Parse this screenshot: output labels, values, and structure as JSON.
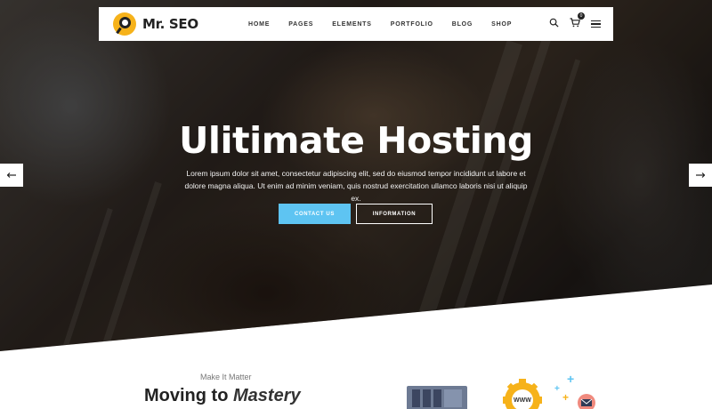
{
  "brand": {
    "name": "Mr. SEO"
  },
  "nav": {
    "items": [
      "HOME",
      "PAGES",
      "ELEMENTS",
      "PORTFOLIO",
      "BLOG",
      "SHOP"
    ],
    "cart_count": "0"
  },
  "icons": {
    "search": "search-icon",
    "cart": "cart-icon",
    "menu": "hamburger-menu-icon",
    "prev": "arrow-left-icon",
    "next": "arrow-right-icon"
  },
  "hero": {
    "title": "Ulitimate Hosting",
    "description": "Lorem ipsum dolor sit amet, consectetur adipiscing elit, sed do eiusmod tempor incididunt ut labore et dolore magna aliqua. Ut enim ad minim veniam, quis nostrud exercitation ullamco laboris nisi ut aliquip ex.",
    "primary_button": "CONTACT US",
    "secondary_button": "INFORMATION"
  },
  "section": {
    "kicker": "Make It Matter",
    "title_bold": "Moving to",
    "title_italic": "Mastery",
    "illustration_label": "WWW"
  },
  "colors": {
    "accent": "#5ec4f2",
    "logo_yellow": "#f6b21a",
    "text_dark": "#222222"
  }
}
